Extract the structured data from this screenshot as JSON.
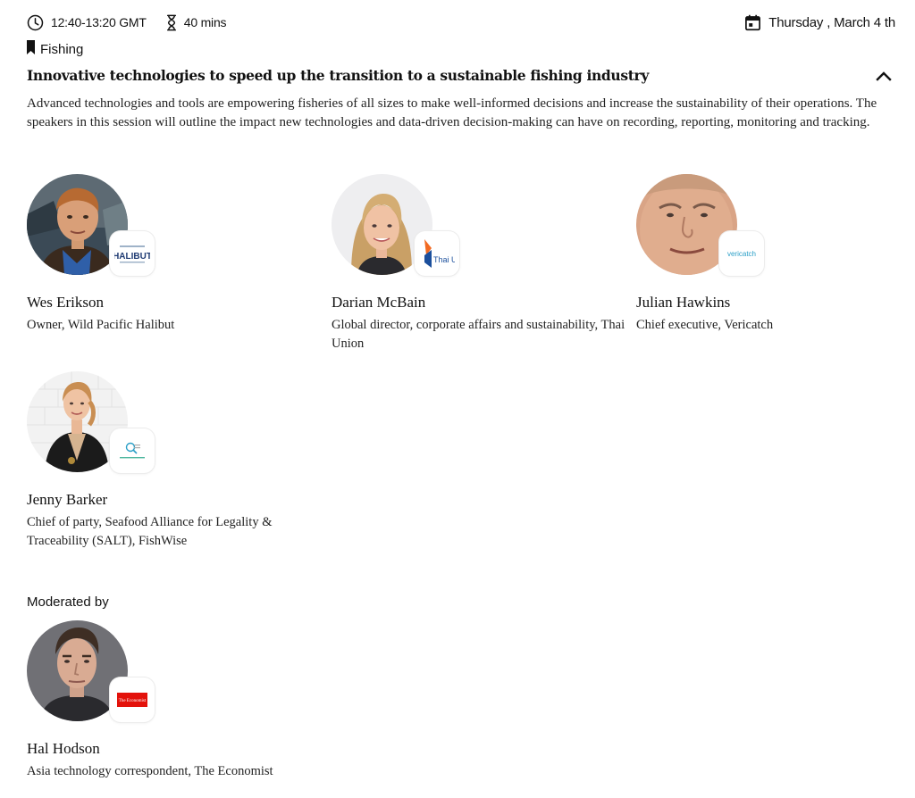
{
  "session": {
    "time": "12:40-13:20 GMT",
    "duration": "40 mins",
    "date": "Thursday , March 4 th",
    "category": "Fishing",
    "title": "Innovative technologies to speed up the transition to a sustainable fishing industry",
    "description": "Advanced technologies and tools are empowering fisheries of all sizes to make well-informed decisions and increase the sustainability of their operations. The speakers in this session will outline the impact new technologies and data-driven decision-making can have on recording, reporting, monitoring and tracking."
  },
  "icons": {
    "time": "clock-icon",
    "duration": "hourglass-icon",
    "date": "calendar-icon",
    "category": "bookmark-icon",
    "collapse": "chevron-up-icon"
  },
  "speakers": [
    {
      "name": "Wes Erikson",
      "role": "Owner, Wild Pacific Halibut",
      "logo_text": "HALIBUT"
    },
    {
      "name": "Darian McBain",
      "role": "Global director, corporate affairs and sustainability, Thai Union",
      "logo_text": "Thai Unic"
    },
    {
      "name": "Julian Hawkins",
      "role": "Chief executive, Vericatch",
      "logo_text": "vericatch"
    },
    {
      "name": "Jenny Barker",
      "role": "Chief of party, Seafood Alliance for Legality & Traceability (SALT), FishWise"
    }
  ],
  "moderation": {
    "label": "Moderated by",
    "moderator": {
      "name": "Hal Hodson",
      "role": "Asia technology correspondent, The Economist",
      "logo_text": "The Economist"
    }
  },
  "colors": {
    "text": "#121212",
    "economist_red": "#e3120b",
    "vericatch_blue": "#2a9fc7",
    "thai_union_blue": "#1b4f9c",
    "thai_union_orange": "#f26a21",
    "halibut_navy": "#1f3b73"
  }
}
